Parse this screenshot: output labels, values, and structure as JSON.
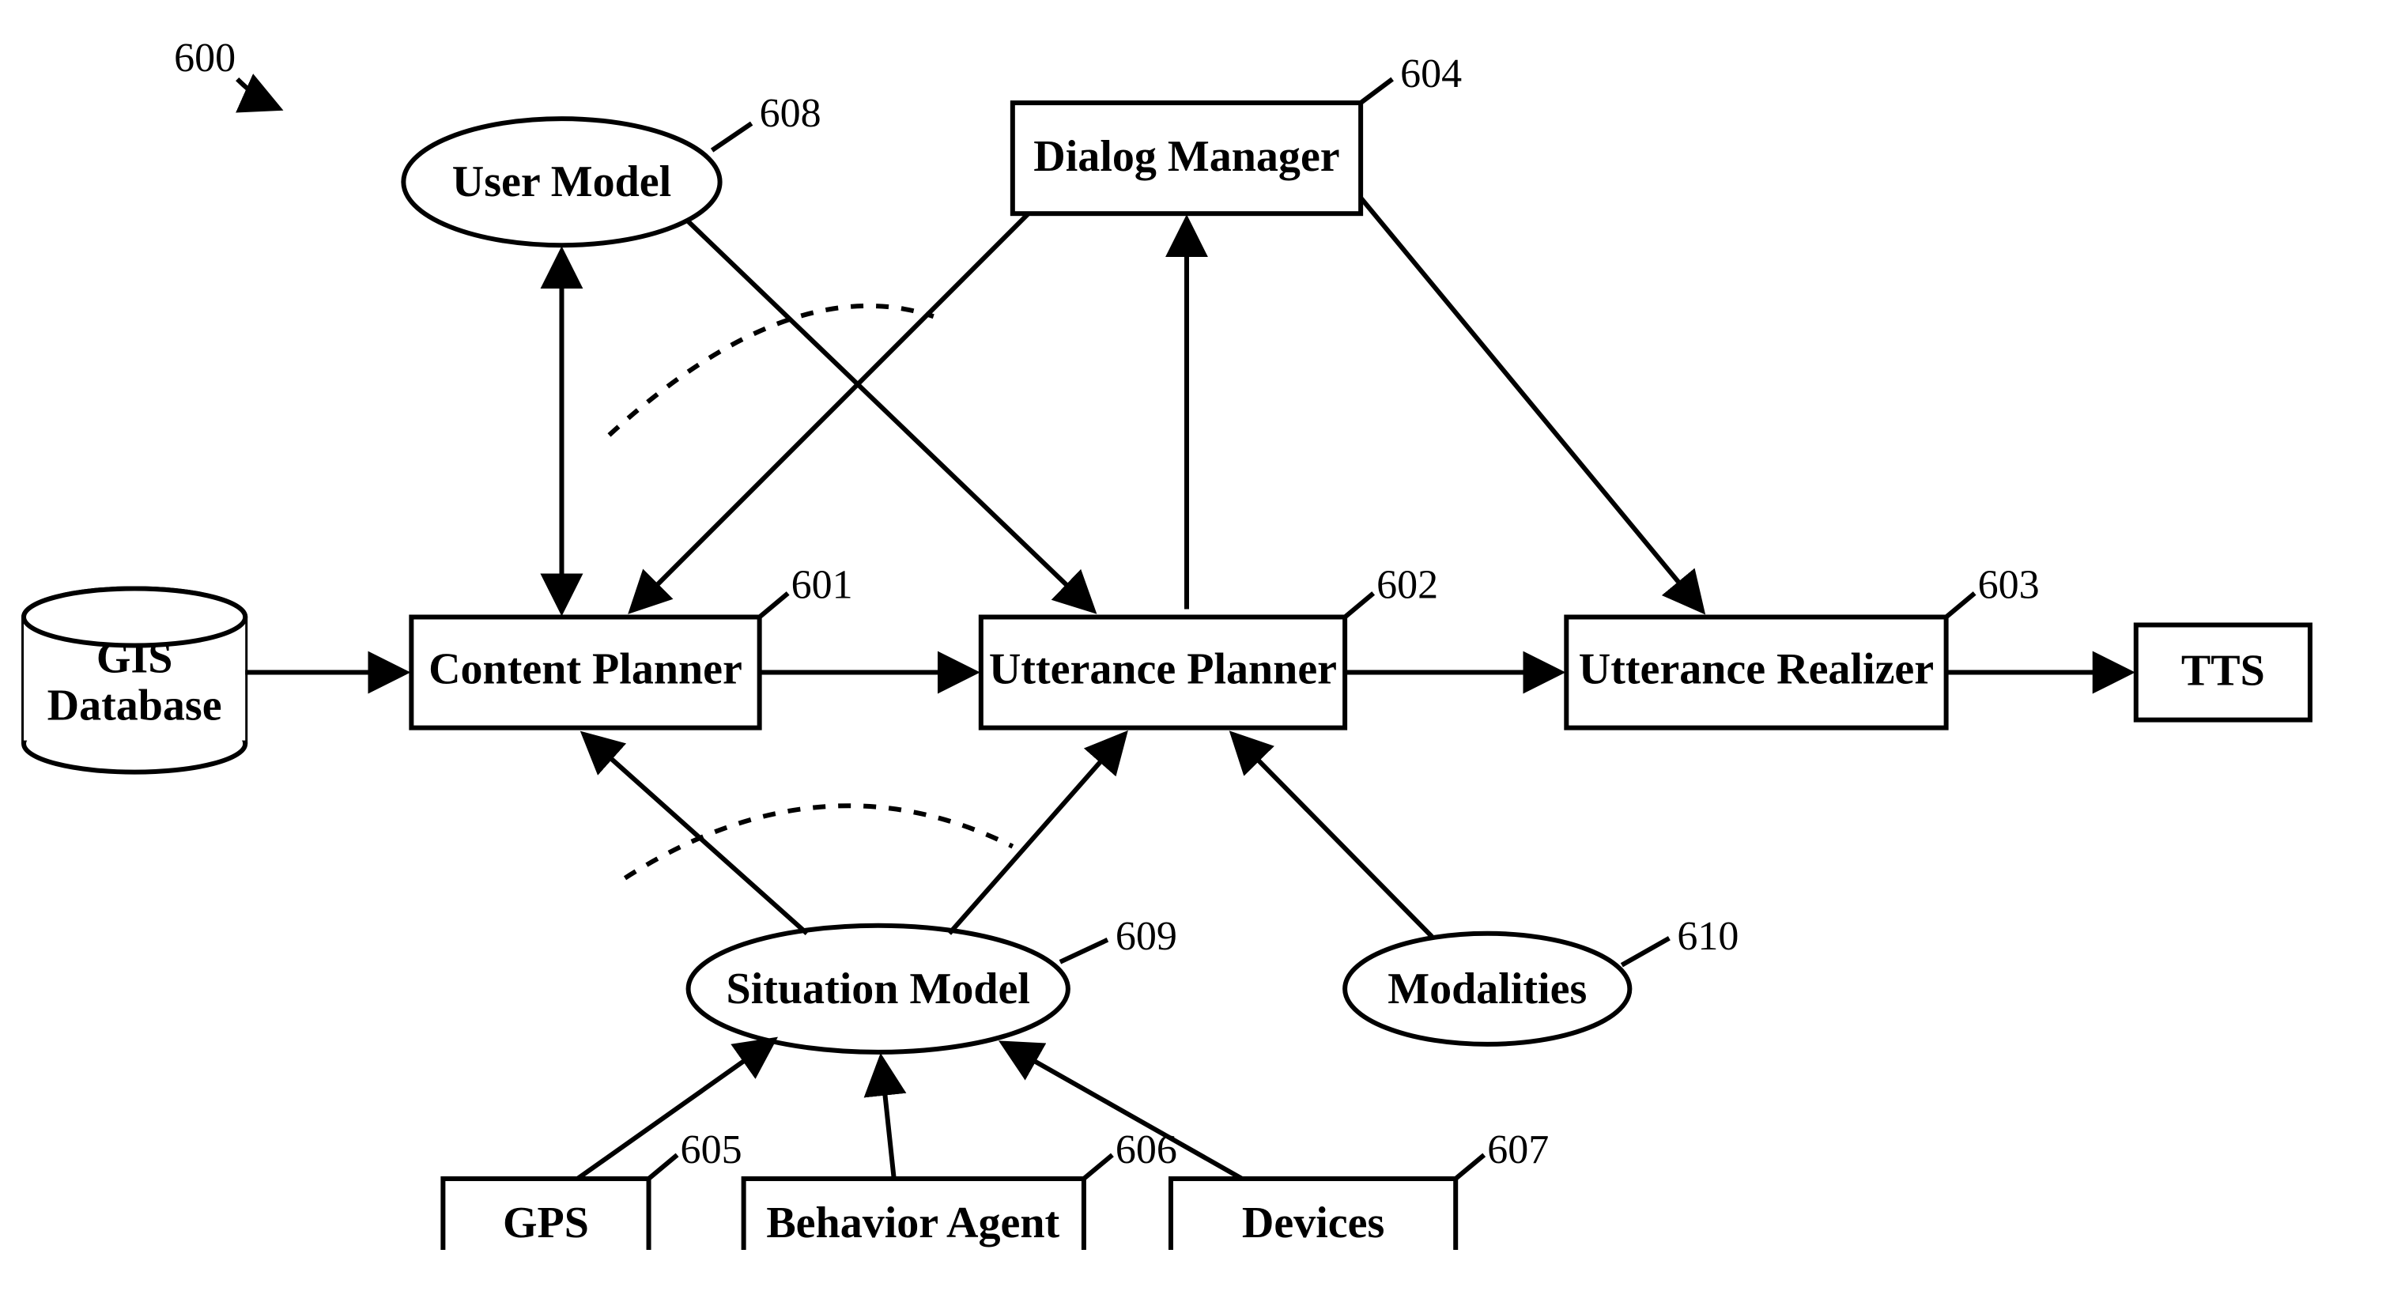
{
  "figure_ref": "600",
  "nodes": {
    "gis": {
      "label_line1": "GIS",
      "label_line2": "Database"
    },
    "content": {
      "label": "Content Planner",
      "ref": "601"
    },
    "utterance": {
      "label": "Utterance Planner",
      "ref": "602"
    },
    "realizer": {
      "label": "Utterance Realizer",
      "ref": "603"
    },
    "tts": {
      "label": "TTS"
    },
    "dialog": {
      "label": "Dialog Manager",
      "ref": "604"
    },
    "usermodel": {
      "label": "User Model",
      "ref": "608"
    },
    "situation": {
      "label": "Situation Model",
      "ref": "609"
    },
    "modalities": {
      "label": "Modalities",
      "ref": "610"
    },
    "gps": {
      "label": "GPS",
      "ref": "605"
    },
    "behavior": {
      "label": "Behavior Agent",
      "ref": "606"
    },
    "devices": {
      "label": "Devices",
      "ref": "607"
    }
  }
}
